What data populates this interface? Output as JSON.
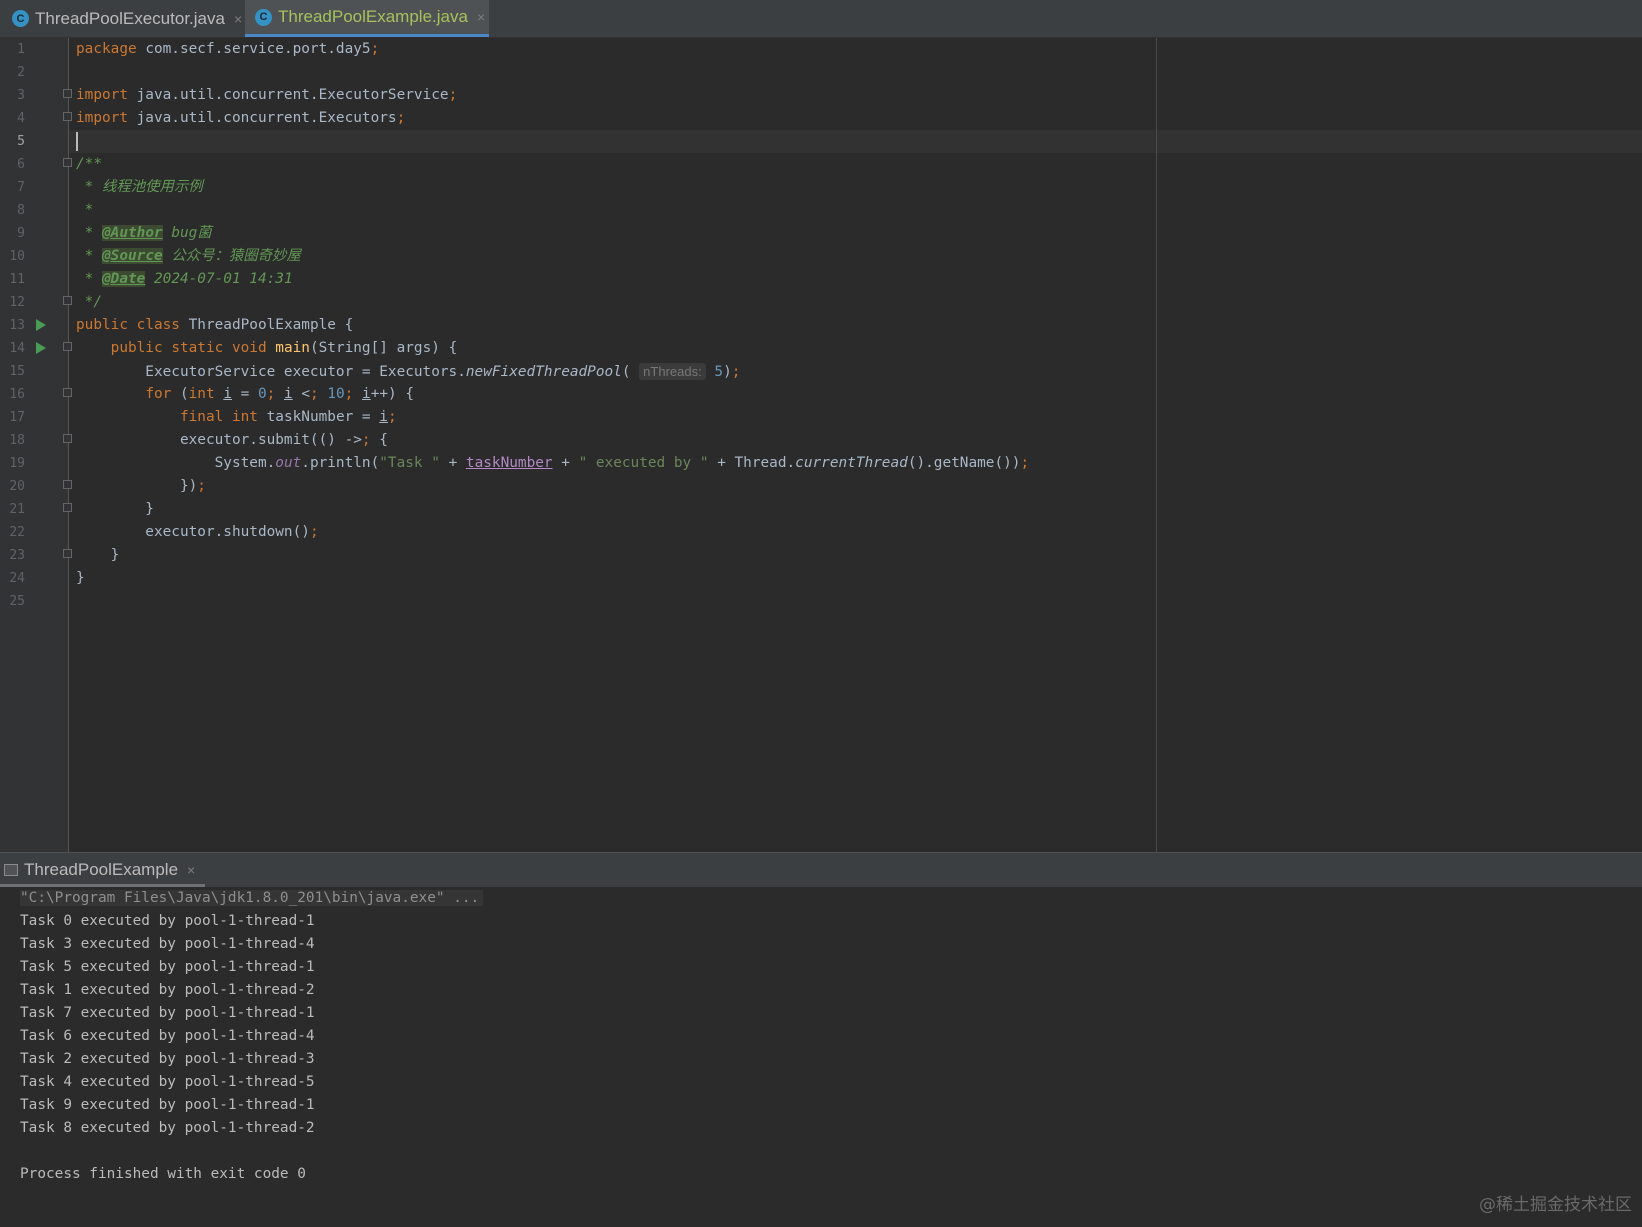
{
  "tabs": [
    {
      "label": "ThreadPoolExecutor.java",
      "icon": "java-class-icon",
      "active": false
    },
    {
      "label": "ThreadPoolExample.java",
      "icon": "java-class-icon",
      "active": true
    }
  ],
  "tab_close_glyph": "×",
  "class_icon_letter": "C",
  "current_line": 5,
  "code_lines": [
    "package com.secf.service.port.day5;",
    "",
    "import java.util.concurrent.ExecutorService;",
    "import java.util.concurrent.Executors;",
    "",
    "/**",
    " * 线程池使用示例",
    " *",
    " * @Author bug菌",
    " * @Source 公众号：猿圈奇妙屋",
    " * @Date 2024-07-01 14:31",
    " */",
    "public class ThreadPoolExample {",
    "    public static void main(String[] args) {",
    "        ExecutorService executor = Executors.newFixedThreadPool( nThreads: 5);",
    "        for (int i = 0; i < 10; i++) {",
    "            final int taskNumber = i;",
    "            executor.submit(() -> {",
    "                System.out.println(\"Task \" + taskNumber + \" executed by \" + Thread.currentThread().getName());",
    "            });",
    "        }",
    "        executor.shutdown();",
    "    }",
    "}",
    ""
  ],
  "run_panel": {
    "tab_label": "ThreadPoolExample"
  },
  "console_lines": [
    "\"C:\\Program Files\\Java\\jdk1.8.0_201\\bin\\java.exe\" ...",
    "Task 0 executed by pool-1-thread-1",
    "Task 3 executed by pool-1-thread-4",
    "Task 5 executed by pool-1-thread-1",
    "Task 1 executed by pool-1-thread-2",
    "Task 7 executed by pool-1-thread-1",
    "Task 6 executed by pool-1-thread-4",
    "Task 2 executed by pool-1-thread-3",
    "Task 4 executed by pool-1-thread-5",
    "Task 9 executed by pool-1-thread-1",
    "Task 8 executed by pool-1-thread-2",
    "",
    "Process finished with exit code 0"
  ],
  "watermark": "@稀土掘金技术社区",
  "colors": {
    "keyword": "#cc7832",
    "comment": "#629755",
    "number": "#6897bb",
    "string": "#6a8759",
    "method": "#ffc66d",
    "text": "#a9b7c6",
    "accent": "#4a88c7"
  }
}
